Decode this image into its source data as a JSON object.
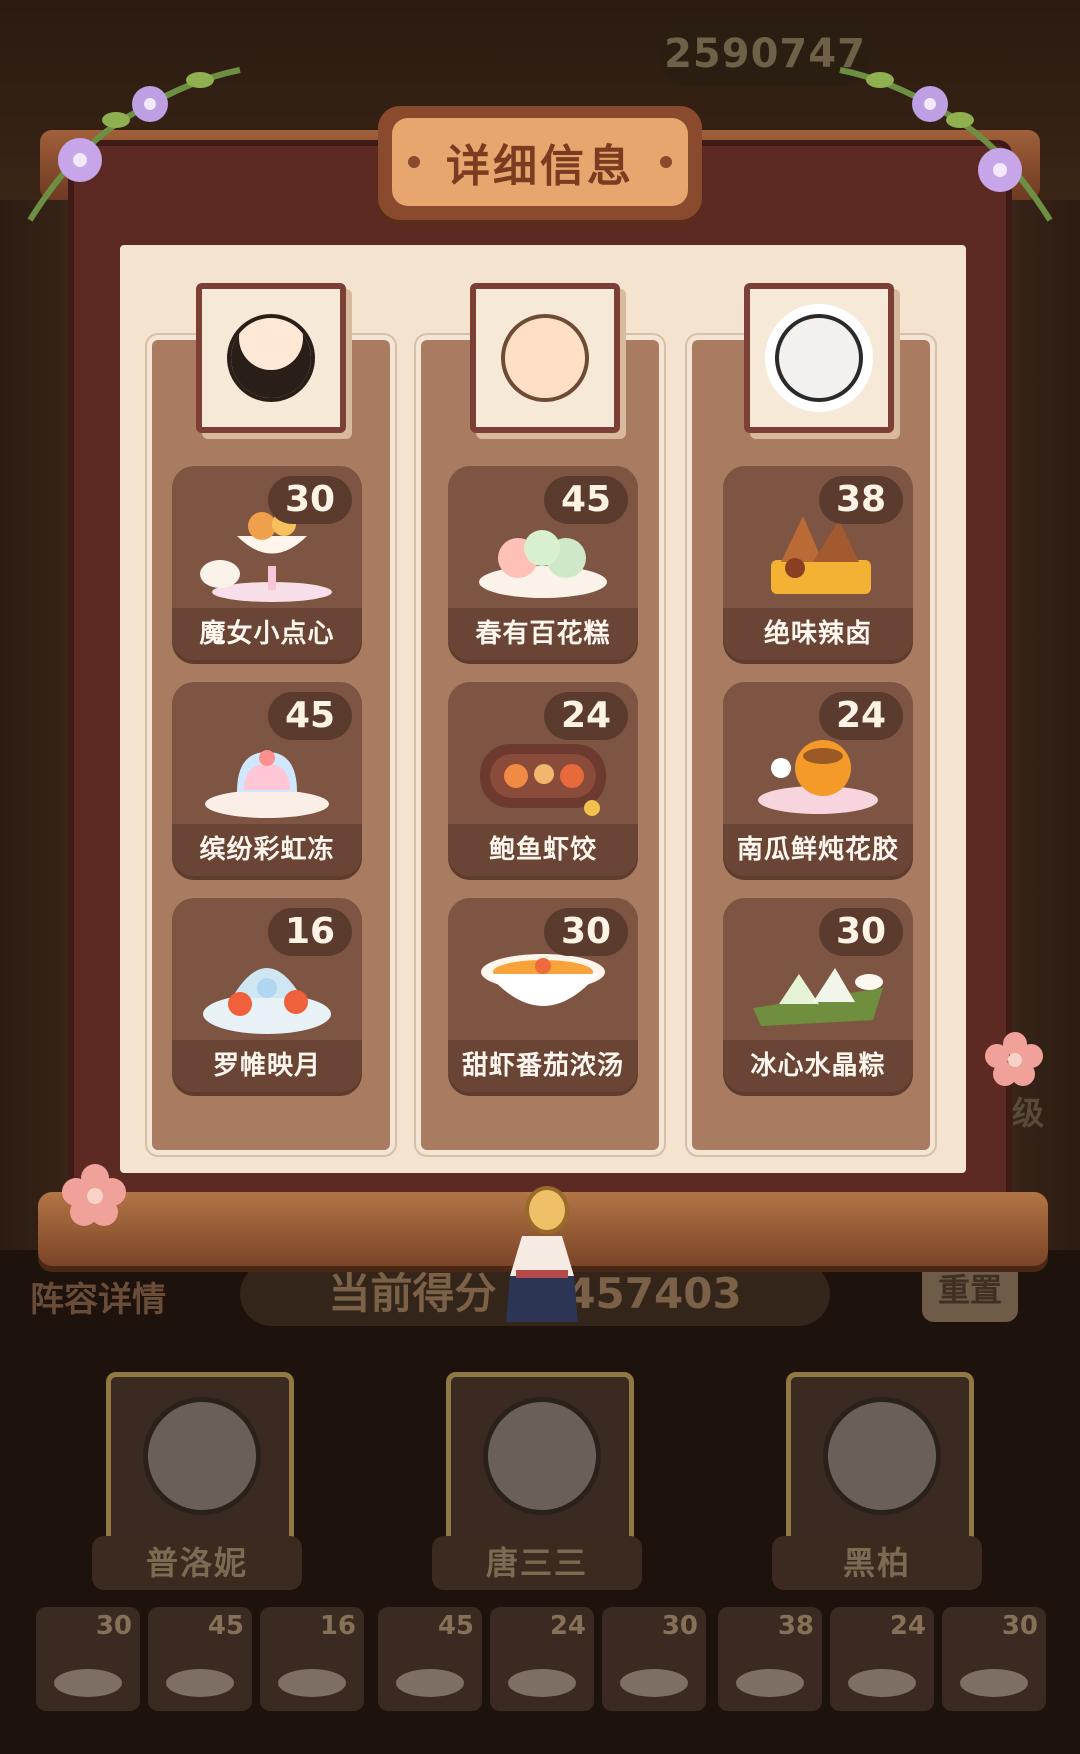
{
  "header": {
    "score_value": "2590747"
  },
  "modal": {
    "title": "详细信息",
    "characters": [
      {
        "name": "普洛妮",
        "dishes": [
          {
            "name": "魔女小点心",
            "count": "30",
            "icon": "dessert-cup-icon"
          },
          {
            "name": "缤纷彩虹冻",
            "count": "45",
            "icon": "jelly-icon"
          },
          {
            "name": "罗帷映月",
            "count": "16",
            "icon": "seafood-platter-icon"
          }
        ]
      },
      {
        "name": "唐三三",
        "dishes": [
          {
            "name": "春有百花糕",
            "count": "45",
            "icon": "flower-cake-icon"
          },
          {
            "name": "鲍鱼虾饺",
            "count": "24",
            "icon": "abalone-dumpling-icon"
          },
          {
            "name": "甜虾番茄浓汤",
            "count": "30",
            "icon": "shrimp-soup-icon"
          }
        ]
      },
      {
        "name": "黑柏",
        "dishes": [
          {
            "name": "绝味辣卤",
            "count": "38",
            "icon": "spicy-braised-icon"
          },
          {
            "name": "南瓜鲜炖花胶",
            "count": "24",
            "icon": "pumpkin-stew-icon"
          },
          {
            "name": "冰心水晶粽",
            "count": "30",
            "icon": "crystal-zongzi-icon"
          }
        ]
      }
    ]
  },
  "background": {
    "formation_label": "阵容详情",
    "current_score_label": "当前得分",
    "current_score_value": "457403",
    "reset_label": "重置",
    "level_fragment": "级",
    "heroes": [
      {
        "name": "普洛妮"
      },
      {
        "name": "唐三三"
      },
      {
        "name": "黑柏"
      }
    ],
    "dish_strip": [
      "30",
      "45",
      "16",
      "45",
      "24",
      "30",
      "38",
      "24",
      "30"
    ]
  },
  "colors": {
    "frame": "#5d2a23",
    "paper": "#f4e3cf",
    "column": "#a97c62",
    "card": "#7e5543",
    "title_plaque": "#e7a66e",
    "accent_flower": "#b79ad8"
  }
}
